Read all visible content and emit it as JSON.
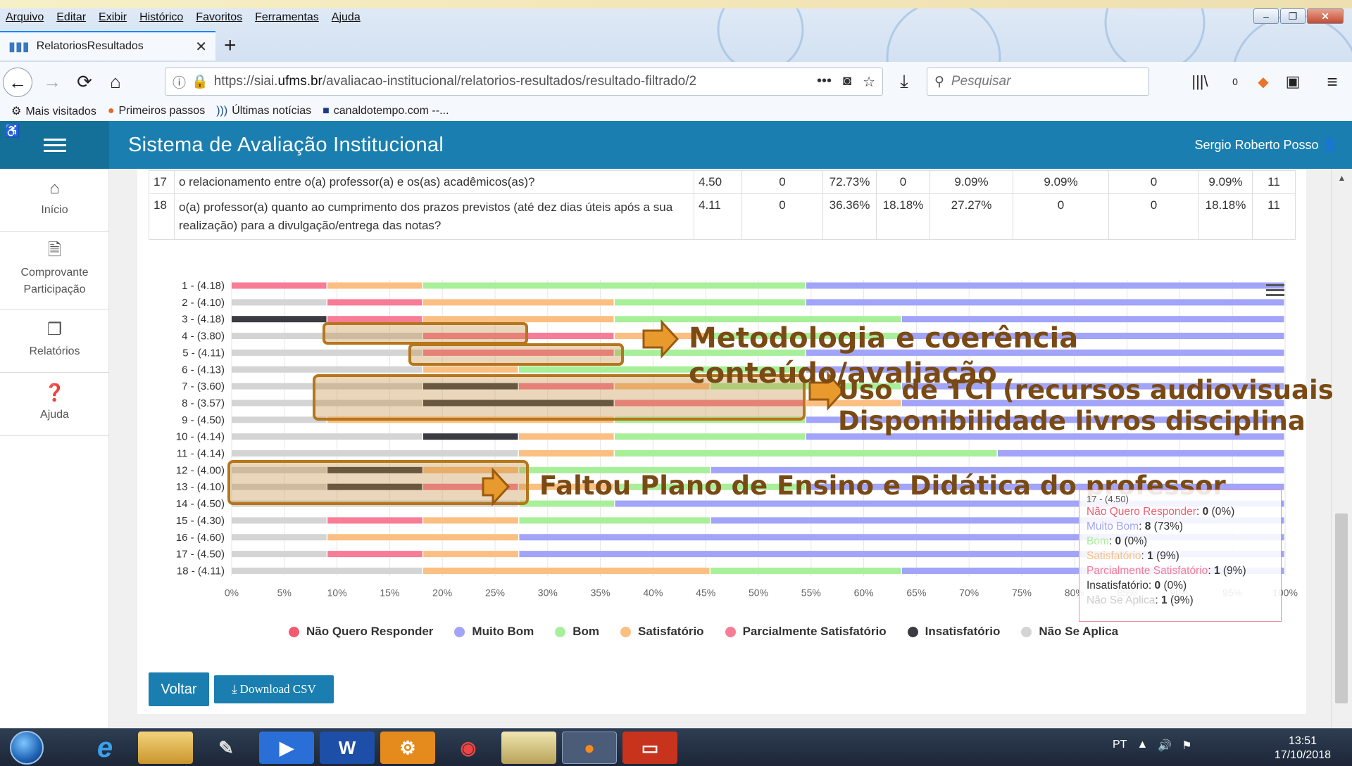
{
  "browser": {
    "menu": [
      "Arquivo",
      "Editar",
      "Exibir",
      "Histórico",
      "Favoritos",
      "Ferramentas",
      "Ajuda"
    ],
    "tab_title": "RelatoriosResultados",
    "url_prefix": "https://siai.",
    "url_domain": "ufms.br",
    "url_path": "/avaliacao-institucional/relatorios-resultados/resultado-filtrado/2",
    "search_placeholder": "Pesquisar",
    "bookmarks": [
      "Mais visitados",
      "Primeiros passos",
      "Últimas notícias",
      "canaldotempo.com --..."
    ],
    "badge": "0"
  },
  "app": {
    "title": "Sistema de Avaliação Institucional",
    "user": "Sergio Roberto Posso"
  },
  "sidebar": [
    {
      "label": "Início"
    },
    {
      "label": "Comprovante Participação"
    },
    {
      "label": "Relatórios"
    },
    {
      "label": "Ajuda"
    }
  ],
  "table": {
    "rows": [
      {
        "n": "17",
        "text": "o relacionamento entre o(a) professor(a) e os(as) acadêmicos(as)?",
        "cells": [
          "4.50",
          "0",
          "72.73%",
          "0",
          "9.09%",
          "9.09%",
          "0",
          "9.09%",
          "11"
        ]
      },
      {
        "n": "18",
        "text": "o(a) professor(a) quanto ao cumprimento dos prazos previstos (até dez dias úteis após a sua realização) para a divulgação/entrega das notas?",
        "cells": [
          "4.11",
          "0",
          "36.36%",
          "18.18%",
          "27.27%",
          "0",
          "0",
          "18.18%",
          "11"
        ]
      }
    ]
  },
  "chart_data": {
    "type": "bar",
    "orientation": "horizontal",
    "stacked": "percent",
    "categories": [
      "1 - (4.18)",
      "2 - (4.10)",
      "3 - (4.18)",
      "4 - (3.80)",
      "5 - (4.11)",
      "6 - (4.13)",
      "7 - (3.60)",
      "8 - (3.57)",
      "9 - (4.50)",
      "10 - (4.14)",
      "11 - (4.14)",
      "12 - (4.00)",
      "13 - (4.10)",
      "14 - (4.50)",
      "15 - (4.30)",
      "16 - (4.60)",
      "17 - (4.50)",
      "18 - (4.11)"
    ],
    "x_ticks": [
      "0%",
      "5%",
      "10%",
      "15%",
      "20%",
      "25%",
      "30%",
      "35%",
      "40%",
      "45%",
      "50%",
      "55%",
      "60%",
      "65%",
      "70%",
      "75%",
      "80%",
      "85%",
      "90%",
      "95%",
      "100%"
    ],
    "series": [
      {
        "name": "Não Quero Responder",
        "color": "#f45b6f",
        "values": [
          0,
          0,
          0,
          0,
          0,
          0,
          0,
          0,
          0,
          0,
          0,
          0,
          0,
          0,
          0,
          0,
          0,
          0
        ]
      },
      {
        "name": "Muito Bom",
        "color": "#a1a4f8",
        "values": [
          45.5,
          45.5,
          36.4,
          36.4,
          45.5,
          45.5,
          36.4,
          36.4,
          45.5,
          45.5,
          27.3,
          54.5,
          45.5,
          63.6,
          54.5,
          72.7,
          72.7,
          36.4
        ]
      },
      {
        "name": "Bom",
        "color": "#a8ef9a",
        "values": [
          36.4,
          18.2,
          27.3,
          18.2,
          18.2,
          27.3,
          18.2,
          0,
          18.2,
          18.2,
          36.4,
          18.2,
          18.2,
          9.1,
          18.2,
          0,
          0,
          18.2
        ]
      },
      {
        "name": "Satisfatório",
        "color": "#fbbf82",
        "values": [
          9.1,
          18.2,
          18.2,
          9.1,
          0,
          9.1,
          9.1,
          9.1,
          27.3,
          9.1,
          9.1,
          9.1,
          9.1,
          0,
          9.1,
          18.2,
          9.1,
          27.3
        ]
      },
      {
        "name": "Parcialmente Satisfatório",
        "color": "#f87c96",
        "values": [
          9.1,
          9.1,
          9.1,
          18.2,
          18.2,
          0,
          9.1,
          18.2,
          0,
          0,
          0,
          0,
          9.1,
          0,
          9.1,
          0,
          9.1,
          0
        ]
      },
      {
        "name": "Insatisfatório",
        "color": "#3b3b42",
        "values": [
          0,
          0,
          9.1,
          0,
          0,
          0,
          9.1,
          18.2,
          0,
          9.1,
          0,
          9.1,
          9.1,
          0,
          0,
          0,
          0,
          0
        ]
      },
      {
        "name": "Não Se Aplica",
        "color": "#d4d4d4",
        "values": [
          0,
          9.1,
          0,
          18.2,
          18.2,
          18.2,
          18.2,
          18.2,
          9.1,
          18.2,
          27.3,
          9.1,
          9.1,
          27.3,
          9.1,
          9.1,
          9.1,
          18.2
        ]
      }
    ]
  },
  "tooltip": {
    "header": "17 - (4.50)",
    "lines": [
      {
        "name": "Não Quero Responder",
        "value": "0",
        "pct": "(0%)",
        "color": "#f45b6f"
      },
      {
        "name": "Muito Bom",
        "value": "8",
        "pct": "(73%)",
        "color": "#a1a4f8"
      },
      {
        "name": "Bom",
        "value": "0",
        "pct": "(0%)",
        "color": "#a8ef9a"
      },
      {
        "name": "Satisfatório",
        "value": "1",
        "pct": "(9%)",
        "color": "#fbbf82"
      },
      {
        "name": "Parcialmente Satisfatório",
        "value": "1",
        "pct": "(9%)",
        "color": "#f87c96"
      },
      {
        "name": "Insatisfatório",
        "value": "0",
        "pct": "(0%)",
        "color": "#333333"
      },
      {
        "name": "Não Se Aplica",
        "value": "1",
        "pct": "(9%)",
        "color": "#cccccc"
      }
    ]
  },
  "annotations": {
    "a1_line1": "Metodologia e coerência",
    "a1_line2": "conteúdo/avaliação",
    "a2_line1": "Uso de TCI  (recursos audiovisuais",
    "a2_line2": "Disponibilidade livros disciplina",
    "a3": "Faltou Plano de Ensino e Didática do professor"
  },
  "buttons": {
    "back": "Voltar",
    "csv": "Download CSV"
  },
  "taskbar": {
    "lang": "PT",
    "time": "13:51",
    "date": "17/10/2018"
  }
}
